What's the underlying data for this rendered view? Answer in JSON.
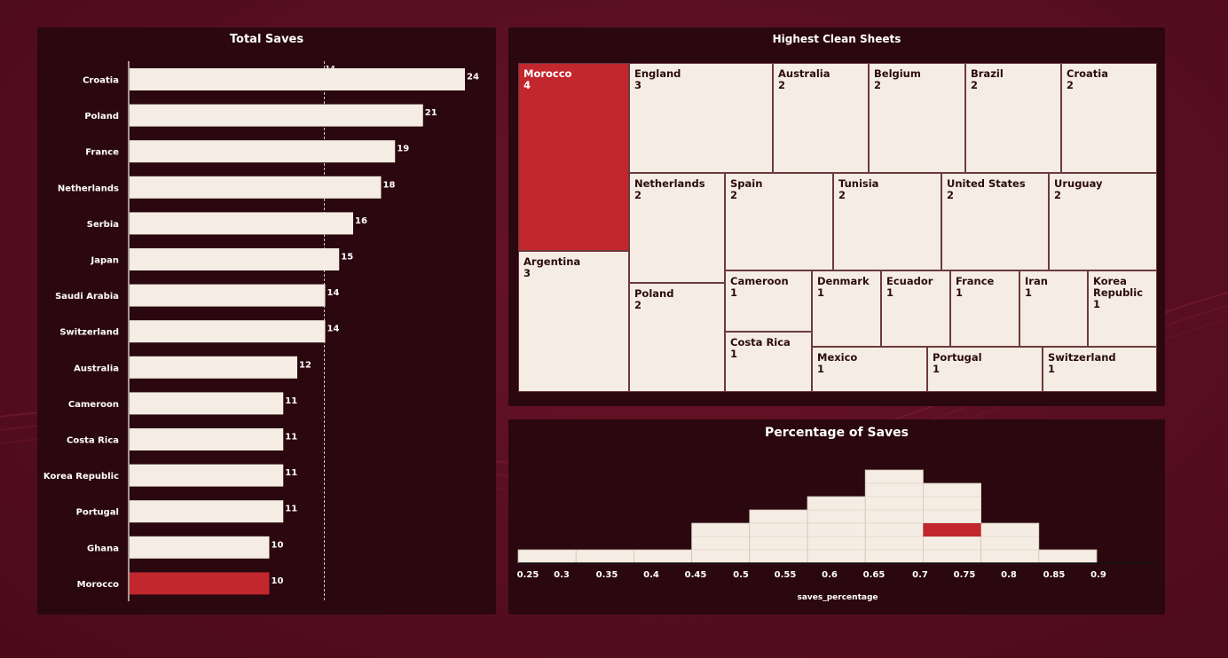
{
  "colors": {
    "background": "#5a0f22",
    "panel": "#2b070f",
    "bar": "#f5ede3",
    "highlight": "#c1272d",
    "text": "#ffffff"
  },
  "chart_data": [
    {
      "type": "bar",
      "orientation": "horizontal",
      "title": "Total Saves",
      "categories": [
        "Croatia",
        "Poland",
        "France",
        "Netherlands",
        "Serbia",
        "Japan",
        "Saudi Arabia",
        "Switzerland",
        "Australia",
        "Cameroon",
        "Costa Rica",
        "Korea Republic",
        "Portugal",
        "Ghana",
        "Morocco"
      ],
      "values": [
        24,
        21,
        19,
        18,
        16,
        15,
        14,
        14,
        12,
        11,
        11,
        11,
        11,
        10,
        10
      ],
      "highlight": "Morocco",
      "reference_line": {
        "value": 14,
        "label": "14"
      },
      "xlim": [
        0,
        30
      ]
    },
    {
      "type": "treemap",
      "title": "Highest Clean Sheets",
      "highlight": "Morocco",
      "items": [
        {
          "name": "Morocco",
          "value": 4
        },
        {
          "name": "Argentina",
          "value": 3
        },
        {
          "name": "England",
          "value": 3
        },
        {
          "name": "Australia",
          "value": 2
        },
        {
          "name": "Belgium",
          "value": 2
        },
        {
          "name": "Brazil",
          "value": 2
        },
        {
          "name": "Croatia",
          "value": 2
        },
        {
          "name": "Netherlands",
          "value": 2
        },
        {
          "name": "Spain",
          "value": 2
        },
        {
          "name": "Tunisia",
          "value": 2
        },
        {
          "name": "United States",
          "value": 2
        },
        {
          "name": "Uruguay",
          "value": 2
        },
        {
          "name": "Poland",
          "value": 2
        },
        {
          "name": "Cameroon",
          "value": 1
        },
        {
          "name": "Denmark",
          "value": 1
        },
        {
          "name": "Ecuador",
          "value": 1
        },
        {
          "name": "France",
          "value": 1
        },
        {
          "name": "Iran",
          "value": 1
        },
        {
          "name": "Korea Republic",
          "value": 1
        },
        {
          "name": "Costa Rica",
          "value": 1
        },
        {
          "name": "Mexico",
          "value": 1
        },
        {
          "name": "Portugal",
          "value": 1
        },
        {
          "name": "Switzerland",
          "value": 1
        }
      ]
    },
    {
      "type": "histogram",
      "title": "Percentage of Saves",
      "xlabel": "saves_percentage",
      "ticks": [
        "0.25",
        "0.3",
        "0.35",
        "0.4",
        "0.45",
        "0.5",
        "0.55",
        "0.6",
        "0.65",
        "0.7",
        "0.75",
        "0.8",
        "0.85",
        "0.9"
      ],
      "bins": [
        {
          "x0": 0.25,
          "x1": 0.3,
          "count": 1
        },
        {
          "x0": 0.3,
          "x1": 0.35,
          "count": 1
        },
        {
          "x0": 0.35,
          "x1": 0.4,
          "count": 1
        },
        {
          "x0": 0.4,
          "x1": 0.45,
          "count": 3
        },
        {
          "x0": 0.45,
          "x1": 0.5,
          "count": 4
        },
        {
          "x0": 0.5,
          "x1": 0.55,
          "count": 5
        },
        {
          "x0": 0.55,
          "x1": 0.6,
          "count": 7
        },
        {
          "x0": 0.6,
          "x1": 0.65,
          "count": 6
        },
        {
          "x0": 0.65,
          "x1": 0.7,
          "count": 3
        },
        {
          "x0": 0.7,
          "x1": 0.75,
          "count": 1
        }
      ],
      "highlight": {
        "bin_index": 7,
        "stack_level": 3
      }
    }
  ]
}
